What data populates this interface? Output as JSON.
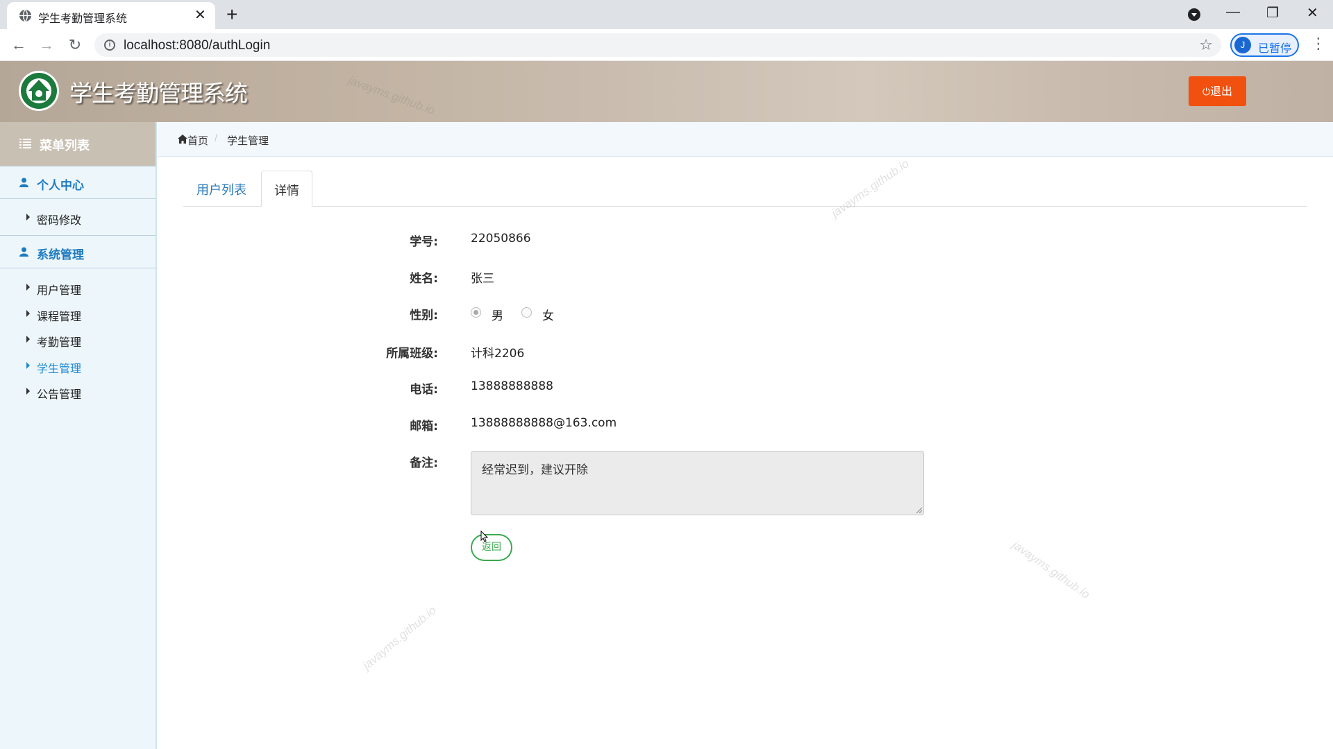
{
  "browser": {
    "tab_title": "学生考勤管理系统",
    "tab_close": "✕",
    "new_tab": "+",
    "url": "localhost:8080/authLogin",
    "profile_initial": "J",
    "profile_status": "已暂停",
    "controls": {
      "minimize": "—",
      "restore": "❐",
      "close": "✕"
    },
    "nav": {
      "back": "←",
      "forward": "→",
      "reload": "↻"
    }
  },
  "header": {
    "app_title": "学生考勤管理系统",
    "logout_label": "退出",
    "logout_color": "#f1500e"
  },
  "sidebar": {
    "menu_title": "菜单列表",
    "groups": [
      {
        "title": "个人中心",
        "items": [
          {
            "label": "密码修改"
          }
        ]
      },
      {
        "title": "系统管理",
        "items": [
          {
            "label": "用户管理"
          },
          {
            "label": "课程管理"
          },
          {
            "label": "考勤管理"
          },
          {
            "label": "学生管理",
            "active": true
          },
          {
            "label": "公告管理"
          }
        ]
      }
    ]
  },
  "breadcrumb": {
    "home": "首页",
    "separator": "/",
    "current": "学生管理"
  },
  "tabs": [
    {
      "label": "用户列表",
      "active": false
    },
    {
      "label": "详情",
      "active": true
    }
  ],
  "form": {
    "student_id": {
      "label": "学号:",
      "value": "22050866"
    },
    "name": {
      "label": "姓名:",
      "value": "张三"
    },
    "gender": {
      "label": "性别:",
      "options": [
        "男",
        "女"
      ],
      "selected": "男"
    },
    "class": {
      "label": "所属班级:",
      "value": "计科2206"
    },
    "phone": {
      "label": "电话:",
      "value": "13888888888"
    },
    "email": {
      "label": "邮箱:",
      "value": "13888888888@163.com"
    },
    "remark": {
      "label": "备注:",
      "value": "经常迟到，建议开除"
    },
    "back_label": "返回"
  },
  "watermark_text": "javayms.github.io",
  "colors": {
    "accent_blue": "#1d7bc0",
    "back_button": "#3aa94f"
  }
}
